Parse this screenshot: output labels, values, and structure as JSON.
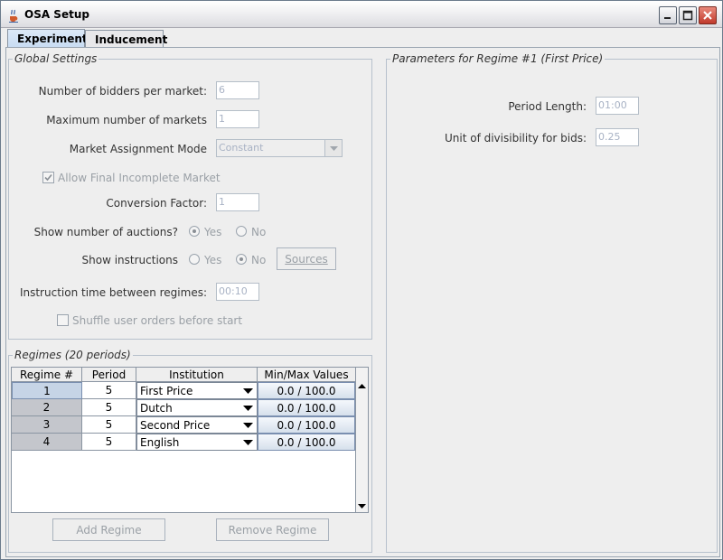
{
  "window": {
    "title": "OSA Setup"
  },
  "tabs": [
    {
      "label": "Experiment",
      "active": true
    },
    {
      "label": "Inducement",
      "active": false
    }
  ],
  "global_settings": {
    "legend": "Global Settings",
    "bidders_label": "Number of bidders per market:",
    "bidders_value": "6",
    "max_markets_label": "Maximum number of markets",
    "max_markets_value": "1",
    "assignment_label": "Market Assignment Mode",
    "assignment_value": "Constant",
    "allow_final_label": "Allow Final Incomplete Market",
    "allow_final_checked": true,
    "conversion_label": "Conversion Factor:",
    "conversion_value": "1",
    "show_auctions_label": "Show number of auctions?",
    "show_auctions_yes": "Yes",
    "show_auctions_no": "No",
    "show_instructions_label": "Show instructions",
    "show_instructions_yes": "Yes",
    "show_instructions_no": "No",
    "sources_button": "Sources",
    "instruction_time_label": "Instruction time between regimes:",
    "instruction_time_value": "00:10",
    "shuffle_label": "Shuffle user orders before start",
    "shuffle_checked": false
  },
  "regimes": {
    "legend": "Regimes (20 periods)",
    "columns": [
      "Regime #",
      "Period",
      "Institution",
      "Min/Max Values"
    ],
    "rows": [
      {
        "regime": "1",
        "period": "5",
        "institution": "First Price",
        "minmax": "0.0 / 100.0"
      },
      {
        "regime": "2",
        "period": "5",
        "institution": "Dutch",
        "minmax": "0.0 / 100.0"
      },
      {
        "regime": "3",
        "period": "5",
        "institution": "Second Price",
        "minmax": "0.0 / 100.0"
      },
      {
        "regime": "4",
        "period": "5",
        "institution": "English",
        "minmax": "0.0 / 100.0"
      }
    ],
    "add_button": "Add Regime",
    "remove_button": "Remove Regime"
  },
  "parameters": {
    "legend": "Parameters for Regime #1 (First Price)",
    "period_length_label": "Period Length:",
    "period_length_value": "01:00",
    "divisibility_label": "Unit of divisibility for bids:",
    "divisibility_value": "0.25"
  },
  "icons": {
    "app": "java-cup-icon",
    "minimize": "minimize-icon",
    "maximize": "maximize-icon",
    "close": "close-icon",
    "dropdown": "chevron-down-icon"
  },
  "colors": {
    "close_button": "#c0392b",
    "tab_active": "#c7dbf2",
    "disabled_text": "#a8b2c4"
  }
}
